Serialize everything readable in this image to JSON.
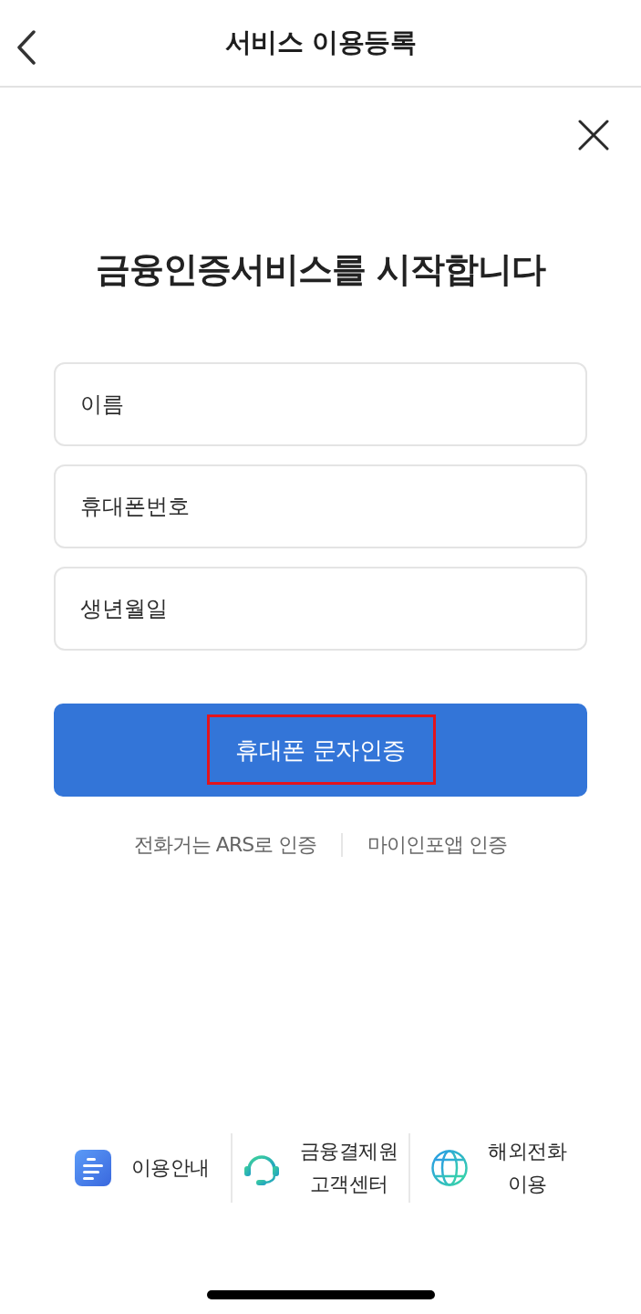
{
  "header": {
    "title": "서비스 이용등록"
  },
  "heading": "금융인증서비스를 시작합니다",
  "fields": [
    {
      "placeholder": "이름"
    },
    {
      "placeholder": "휴대폰번호"
    },
    {
      "placeholder": "생년월일"
    }
  ],
  "primary_button": {
    "label": "휴대폰 문자인증",
    "highlighted": true
  },
  "alt_links": [
    "전화거는 ARS로 인증",
    "마이인포앱 인증"
  ],
  "footer_items": [
    {
      "kind": "document",
      "label": "이용안내"
    },
    {
      "kind": "headset",
      "label": "금융결제원\n고객센터"
    },
    {
      "kind": "globe",
      "label": "해외전화\n이용"
    }
  ]
}
